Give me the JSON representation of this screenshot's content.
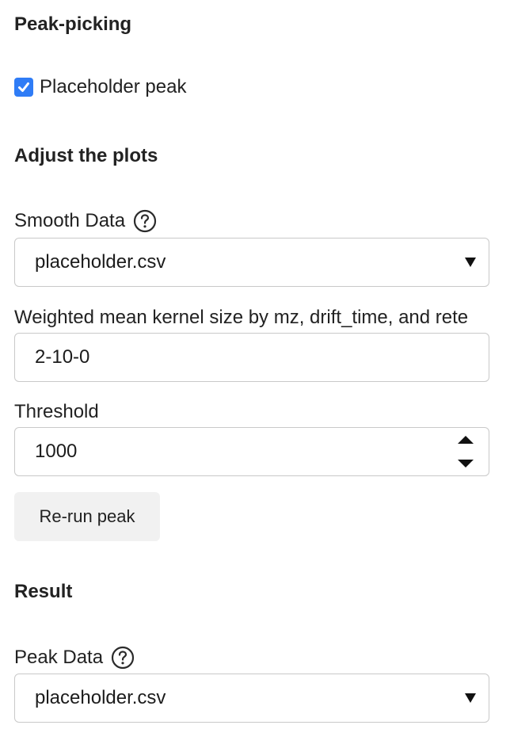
{
  "peak_picking": {
    "title": "Peak-picking",
    "checkbox_label": "Placeholder peak",
    "checkbox_checked": true
  },
  "adjust": {
    "title": "Adjust the plots",
    "smooth_label": "Smooth Data",
    "smooth_value": "placeholder.csv",
    "kernel_label": "Weighted mean kernel size by mz, drift_time, and rete",
    "kernel_value": "2-10-0",
    "threshold_label": "Threshold",
    "threshold_value": "1000",
    "rerun_button": "Re-run peak"
  },
  "result": {
    "title": "Result",
    "peak_label": "Peak Data",
    "peak_value": "placeholder.csv"
  },
  "colors": {
    "accent": "#2f7cf6",
    "border": "#c9c9c9",
    "button_bg": "#f1f1f1"
  },
  "icons": {
    "help": "question-circle-icon",
    "select": "caret-down-icon",
    "spinner": "up-down-arrows-icon"
  }
}
